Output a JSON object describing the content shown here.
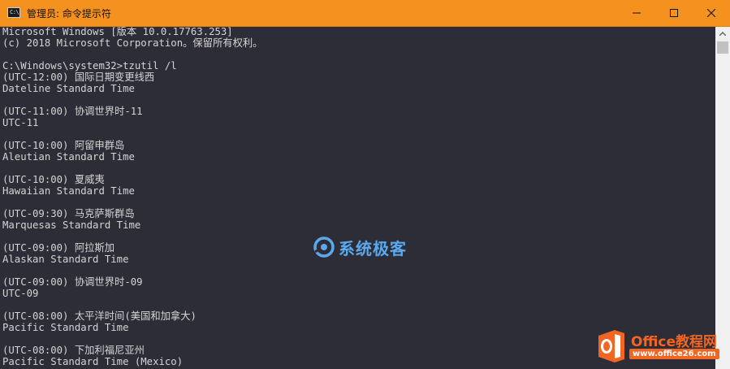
{
  "window": {
    "icon_text": "C:\\",
    "title": "管理员: 命令提示符"
  },
  "console": {
    "lines": [
      "Microsoft Windows [版本 10.0.17763.253]",
      "(c) 2018 Microsoft Corporation。保留所有权利。",
      "",
      "C:\\Windows\\system32>tzutil /l",
      "(UTC-12:00) 国际日期变更线西",
      "Dateline Standard Time",
      "",
      "(UTC-11:00) 协调世界时-11",
      "UTC-11",
      "",
      "(UTC-10:00) 阿留申群岛",
      "Aleutian Standard Time",
      "",
      "(UTC-10:00) 夏威夷",
      "Hawaiian Standard Time",
      "",
      "(UTC-09:30) 马克萨斯群岛",
      "Marquesas Standard Time",
      "",
      "(UTC-09:00) 阿拉斯加",
      "Alaskan Standard Time",
      "",
      "(UTC-09:00) 协调世界时-09",
      "UTC-09",
      "",
      "(UTC-08:00) 太平洋时间(美国和加拿大)",
      "Pacific Standard Time",
      "",
      "(UTC-08:00) 下加利福尼亚州",
      "Pacific Standard Time (Mexico)"
    ]
  },
  "watermarks": {
    "system_geek": "系统极客",
    "office_name": "Office教程网",
    "office_url": "www.office26.com"
  },
  "colors": {
    "titlebar": "#f5921f",
    "console_bg": "#2d2d37",
    "console_text": "#d4d4d4",
    "scrollbar_bg": "#f0f0f0",
    "scrollbar_thumb": "#c1c1c1"
  }
}
